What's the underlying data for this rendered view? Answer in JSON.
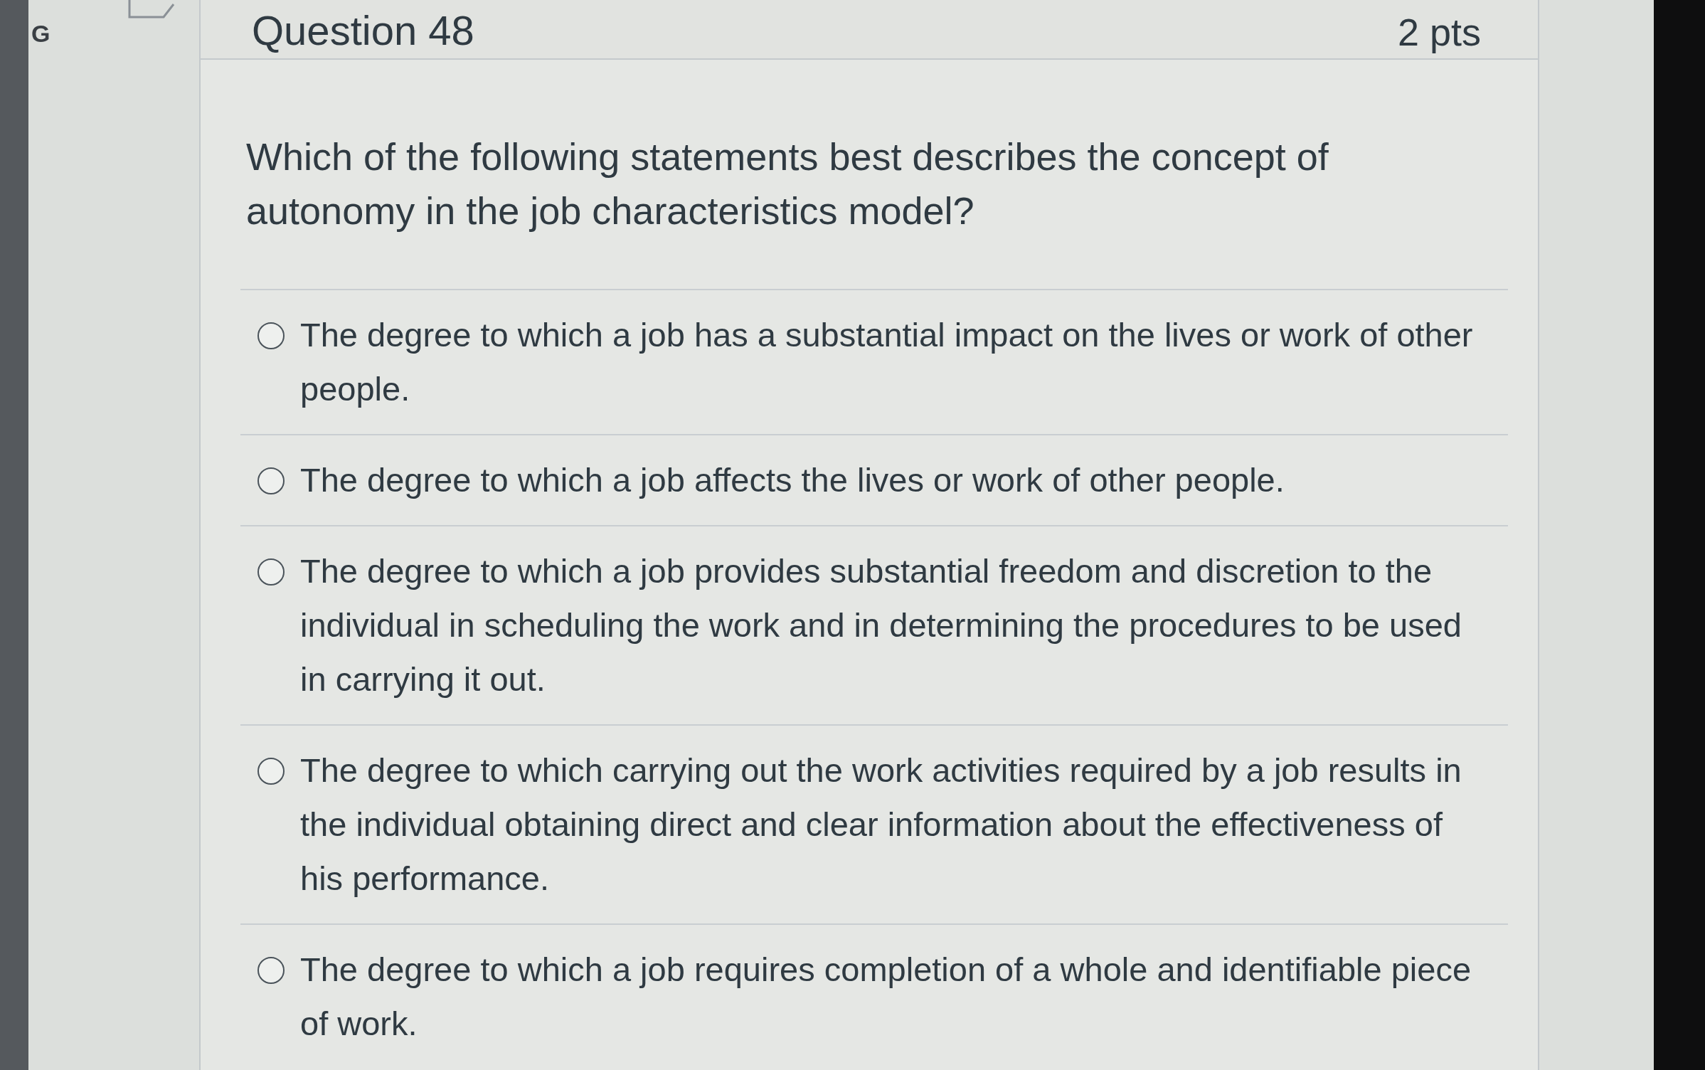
{
  "sidebar": {
    "letter": "G"
  },
  "question": {
    "title": "Question 48",
    "points": "2 pts",
    "text": "Which of the following statements best describes the concept of autonomy in the job characteristics model?",
    "answers": [
      {
        "text": "The degree to which a job has a substantial impact on the lives or work of other people.",
        "selected": false
      },
      {
        "text": "The degree to which a job affects the lives or work of other people.",
        "selected": false
      },
      {
        "text": "The degree to which a job provides substantial freedom and discretion to the individual in scheduling the work and in determining the procedures to be used in carrying it out.",
        "selected": false
      },
      {
        "text": "The degree to which carrying out the work activities required by a job results in the individual obtaining direct and clear information about the effectiveness of his performance.",
        "selected": false
      },
      {
        "text": "The degree to which a job requires completion of a whole and identifiable piece of work.",
        "selected": false
      }
    ]
  }
}
